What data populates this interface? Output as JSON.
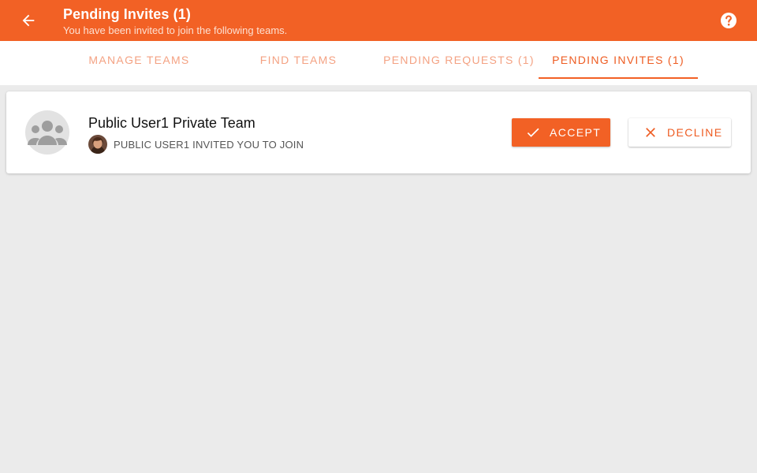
{
  "header": {
    "title": "Pending Invites (1)",
    "subtitle": "You have been invited to join the following teams.",
    "back_icon": "arrow-back-icon",
    "help_icon": "help-circle-icon"
  },
  "tabs": [
    {
      "label": "MANAGE TEAMS",
      "active": false
    },
    {
      "label": "FIND TEAMS",
      "active": false
    },
    {
      "label": "PENDING REQUESTS (1)",
      "active": false
    },
    {
      "label": "PENDING INVITES (1)",
      "active": true
    }
  ],
  "invites": [
    {
      "team_name": "Public User1 Private Team",
      "invite_text": "PUBLIC USER1 INVITED YOU TO JOIN",
      "team_icon": "group-icon",
      "inviter_icon": "user-photo-icon",
      "accept_label": "ACCEPT",
      "accept_icon": "check-icon",
      "decline_label": "DECLINE",
      "decline_icon": "close-icon"
    }
  ],
  "colors": {
    "brand": "#f26125",
    "tab_inactive": "#f4a283",
    "background": "#ebebeb"
  }
}
